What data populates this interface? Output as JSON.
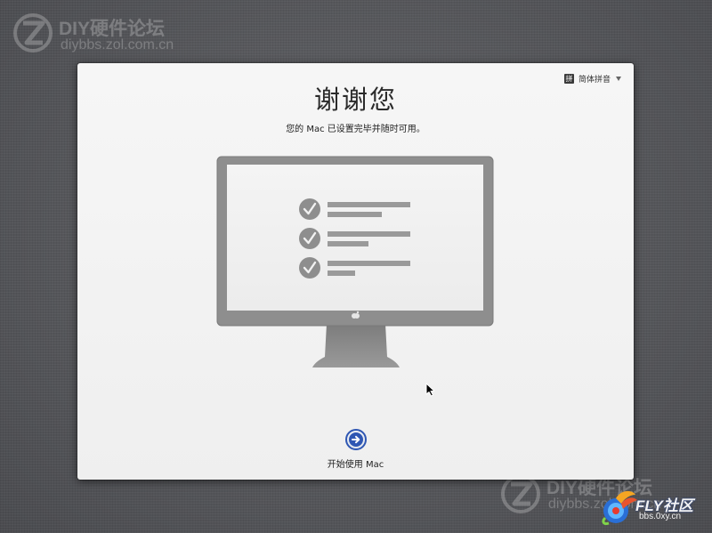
{
  "watermark_top": {
    "name": "DIY硬件论坛",
    "url": "diybbs.zol.com.cn"
  },
  "watermark_bottom": {
    "name": "DIY硬件论坛",
    "url": "diybbs.zol.com.cn"
  },
  "fly_logo": {
    "name": "FLY社区",
    "url": "bbs.0xy.cn"
  },
  "input_menu": {
    "label": "简体拼音",
    "icon": "pinyin-input-icon"
  },
  "title": "谢谢您",
  "subtitle": "您的 Mac 已设置完毕并随时可用。",
  "continue_button": {
    "label": "开始使用 Mac",
    "icon": "arrow-right-icon"
  },
  "colors": {
    "accent": "#2f57b3",
    "panel_bg": "#f3f3f3",
    "illustration_gray": "#8e8e8e",
    "desktop_bg": "#595a5e"
  }
}
